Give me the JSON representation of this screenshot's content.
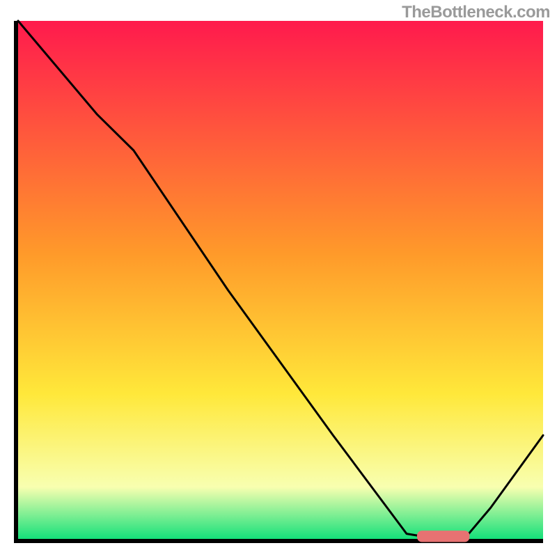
{
  "watermark": "TheBottleneck.com",
  "colors": {
    "gradient_stops": [
      {
        "offset": "0%",
        "color": "#ff1a4d"
      },
      {
        "offset": "45%",
        "color": "#ff9a2a"
      },
      {
        "offset": "72%",
        "color": "#ffe83a"
      },
      {
        "offset": "90%",
        "color": "#f8ffb0"
      },
      {
        "offset": "100%",
        "color": "#14e07a"
      }
    ],
    "curve": "#000000",
    "marker": "#e77272",
    "axes": "#000000"
  },
  "chart_data": {
    "type": "line",
    "title": "",
    "xlabel": "",
    "ylabel": "",
    "xlim": [
      0,
      100
    ],
    "ylim": [
      0,
      100
    ],
    "grid": false,
    "legend": false,
    "series": [
      {
        "name": "bottleneck-curve",
        "x": [
          0,
          5,
          15,
          22,
          40,
          60,
          74,
          80,
          85,
          90,
          100
        ],
        "y": [
          100,
          94,
          82,
          75,
          48,
          20,
          1,
          0,
          0,
          6,
          20
        ]
      }
    ],
    "optimal_range": {
      "x_start": 76,
      "x_end": 86,
      "y": 0.5,
      "thickness": 2.2
    }
  }
}
